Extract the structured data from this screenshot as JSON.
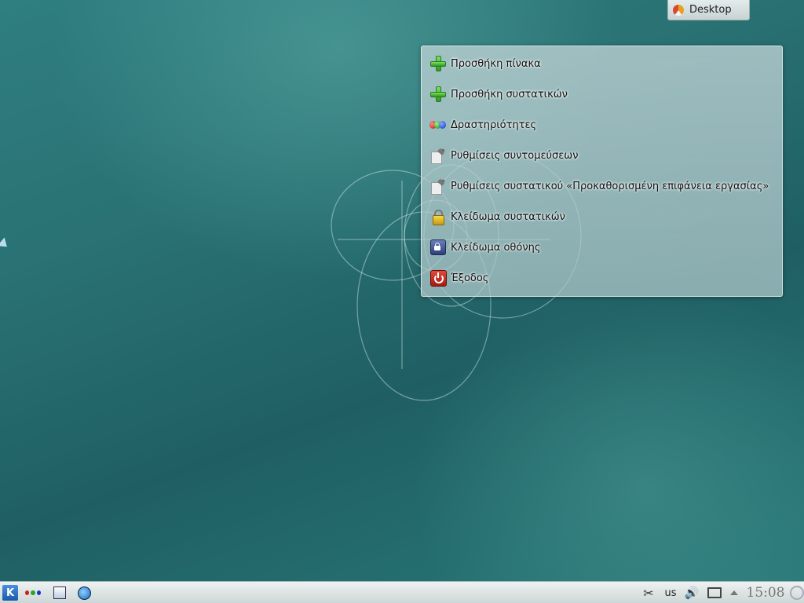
{
  "desktop_tab": {
    "label": "Desktop"
  },
  "context_menu": {
    "items": [
      {
        "label": "Προσθήκη πίνακα",
        "icon": "add-icon"
      },
      {
        "label": "Προσθήκη συστατικών",
        "icon": "add-icon"
      },
      {
        "label": "Δραστηριότητες",
        "icon": "activities-icon"
      },
      {
        "label": "Ρυθμίσεις συντομεύσεων",
        "icon": "settings-tool-icon"
      },
      {
        "label": "Ρυθμίσεις συστατικού «Προκαθορισμένη επιφάνεια εργασίας»",
        "icon": "settings-tool-icon"
      },
      {
        "label": "Κλείδωμα συστατικών",
        "icon": "lock-icon"
      },
      {
        "label": "Κλείδωμα οθόνης",
        "icon": "screen-lock-icon"
      },
      {
        "label": "Έξοδος",
        "icon": "power-icon"
      }
    ]
  },
  "panel": {
    "keyboard_layout": "us",
    "clock": "15:08"
  }
}
